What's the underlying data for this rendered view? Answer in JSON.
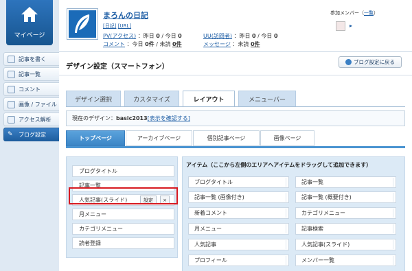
{
  "nav": {
    "mypage_label": "マイページ",
    "items": [
      {
        "label": "記事を書く",
        "icon": "pencil-icon"
      },
      {
        "label": "記事一覧",
        "icon": "list-icon"
      },
      {
        "label": "コメント",
        "icon": "comment-icon"
      },
      {
        "label": "画像 / ファイル",
        "icon": "image-icon"
      },
      {
        "label": "アクセス解析",
        "icon": "chart-icon"
      },
      {
        "label": "ブログ設定",
        "icon": "wrench-icon"
      }
    ]
  },
  "header": {
    "blog_name": "まろんの日記",
    "link_diary": "[日記]",
    "link_url": "[URL]",
    "pv_label": "PV(アクセス)",
    "pv_text": "：昨日",
    "pv_yesterday": "0",
    "pv_today_text": "/ 今日",
    "pv_today": "0",
    "uu_label": "UU(訪問者)",
    "uu_text": "：昨日",
    "uu_yesterday": "0",
    "uu_today_text": "/ 今日",
    "uu_today": "0",
    "comment_label": "コメント",
    "comment_text": "：今日",
    "comment_today": "0件",
    "comment_unread_text": "/ 未読",
    "comment_unread": "0件",
    "message_label": "メッセージ",
    "message_text": "：未読",
    "message_unread": "0件",
    "members_label": "参加メンバー",
    "members_link": "一覧"
  },
  "page": {
    "title": "デザイン設定（スマートフォン）",
    "back_button": "ブログ設定に戻る"
  },
  "tabs": [
    "デザイン選択",
    "カスタマイズ",
    "レイアウト",
    "メニューバー"
  ],
  "active_tab": "レイアウト",
  "current_design": {
    "prefix": "現在のデザイン：",
    "name": "basic2013",
    "link": "[表示を確認する]"
  },
  "subtabs": [
    "トップページ",
    "アーカイブページ",
    "個別記事ページ",
    "画像ページ"
  ],
  "active_subtab": "トップページ",
  "left_items": [
    "ブログタイトル",
    "記事一覧",
    "人気記事(スライド)",
    "月メニュー",
    "カテゴリメニュー",
    "読者登録"
  ],
  "selected_item_buttons": {
    "settings": "設定",
    "remove": "×"
  },
  "right_panel": {
    "header": "アイテム（ここから左側のエリアへアイテムをドラッグして追加できます）",
    "items": [
      "ブログタイトル",
      "記事一覧",
      "記事一覧 (画像付き)",
      "記事一覧 (概要付き)",
      "新着コメント",
      "カテゴリメニュー",
      "月メニュー",
      "記事検索",
      "人気記事",
      "人気記事(スライド)",
      "プロフィール",
      "メンバー一覧"
    ]
  },
  "colors": {
    "accent": "#1f5fa0",
    "highlight": "#d71a21"
  }
}
